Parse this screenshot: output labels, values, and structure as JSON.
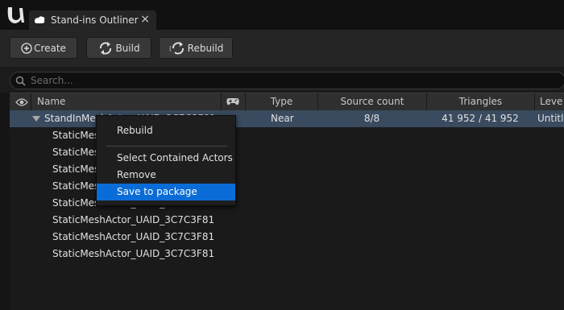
{
  "tab": {
    "title": "Stand-ins Outliner",
    "close": "×"
  },
  "toolbar": {
    "create": "Create",
    "build": "Build",
    "rebuild": "Rebuild"
  },
  "search": {
    "placeholder": "Search..."
  },
  "columns": {
    "name": "Name",
    "type": "Type",
    "source_count": "Source count",
    "triangles": "Triangles",
    "level": "Leve"
  },
  "selected_row": {
    "name": "StandInMeshActor_UAID_3C7C3F81",
    "type": "Near",
    "source_count": "8/8",
    "triangles": "41 952 / 41 952",
    "level": "Untitle"
  },
  "children": [
    "StaticMeshActor_UAID_3C7C3F81",
    "StaticMeshActor_UAID_3C7C3F81",
    "StaticMeshActor_UAID_3C7C3F81",
    "StaticMeshActor_UAID_3C7C3F81",
    "StaticMeshActor_UAID_3C7C3F81",
    "StaticMeshActor_UAID_3C7C3F81",
    "StaticMeshActor_UAID_3C7C3F81",
    "StaticMeshActor_UAID_3C7C3F81"
  ],
  "context_menu": {
    "rebuild": "Rebuild",
    "select_contained": "Select Contained Actors",
    "remove": "Remove",
    "save_to_package": "Save to package"
  },
  "icons": [
    "unreal-logo-icon",
    "standin-tab-icon",
    "create-plus-icon",
    "build-icon",
    "rebuild-icon",
    "search-icon",
    "eye-icon",
    "gamepad-icon",
    "expand-triangle-icon"
  ],
  "colors": {
    "selection": "#3a4a5f",
    "menu_highlight": "#0a6cd6"
  }
}
